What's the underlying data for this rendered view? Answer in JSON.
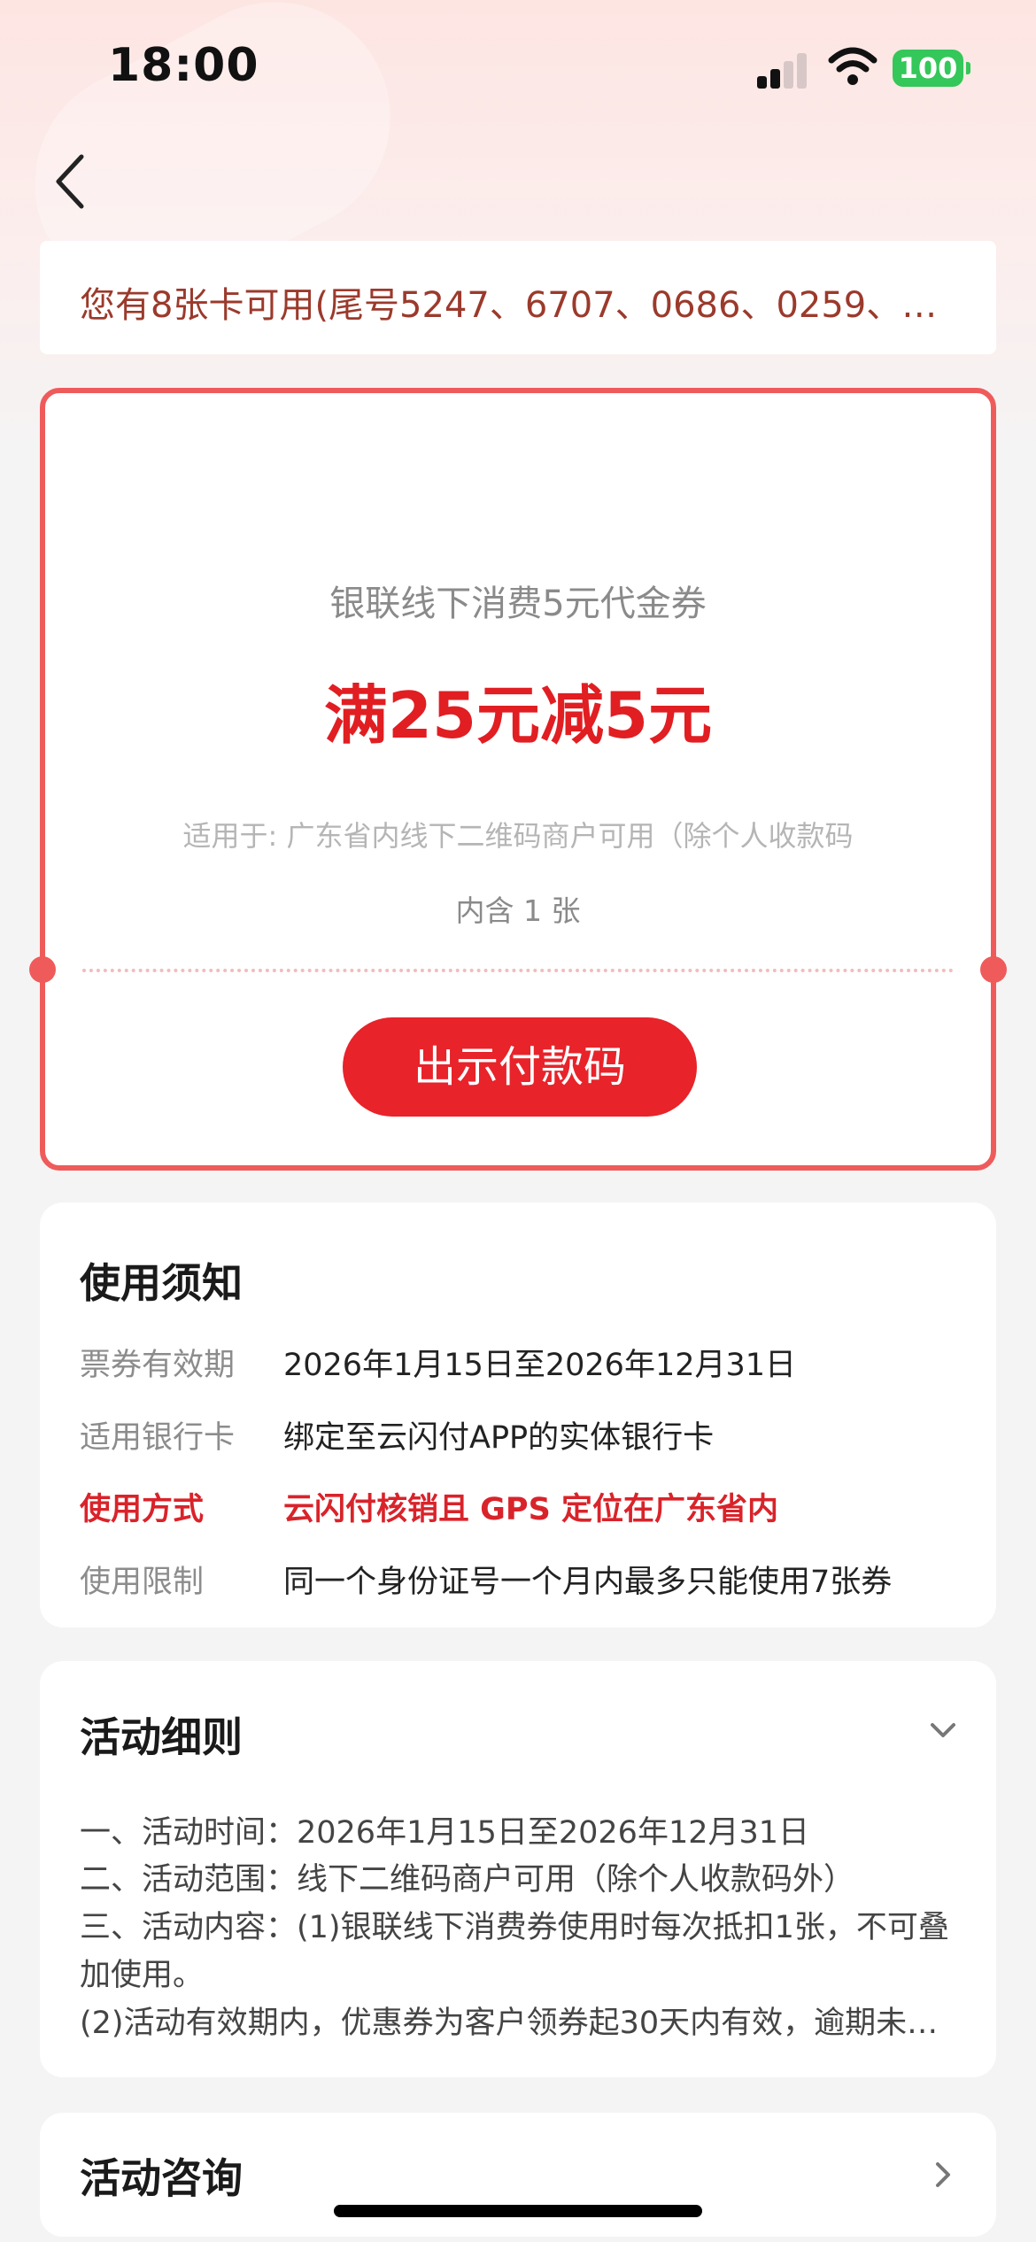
{
  "status_bar": {
    "time": "18:00",
    "battery": "100"
  },
  "notice": {
    "text": "您有8张卡可用(尾号5247、6707、0686、0259、…"
  },
  "coupon": {
    "name": "银联线下消费5元代金券",
    "value": "满25元减5元",
    "scope": "适用于: 广东省内线下二维码商户可用（除个人收款码",
    "quantity": "内含 1 张",
    "pay_button": "出示付款码"
  },
  "usage": {
    "title": "使用须知",
    "rows": [
      {
        "label": "票券有效期",
        "value": "2026年1月15日至2026年12月31日"
      },
      {
        "label": "适用银行卡",
        "value": "绑定至云闪付APP的实体银行卡"
      },
      {
        "label": "使用方式",
        "value": "云闪付核销且 GPS 定位在广东省内"
      },
      {
        "label": "使用限制",
        "value": "同一个身份证号一个月内最多只能使用7张券"
      }
    ]
  },
  "rules": {
    "title": "活动细则",
    "lines": [
      "一、活动时间：2026年1月15日至2026年12月31日",
      "二、活动范围：线下二维码商户可用（除个人收款码外）",
      "三、活动内容：(1)银联线下消费券使用时每次抵扣1张，不可叠",
      "加使用。",
      "(2)活动有效期内，优惠券为客户领券起30天内有效，逾期未…"
    ]
  },
  "consult": {
    "title": "活动咨询"
  },
  "colors": {
    "accent": "#e8232a",
    "coupon_border": "#ef5b5b",
    "notice_text": "#9b3a2c",
    "battery": "#34c759"
  }
}
